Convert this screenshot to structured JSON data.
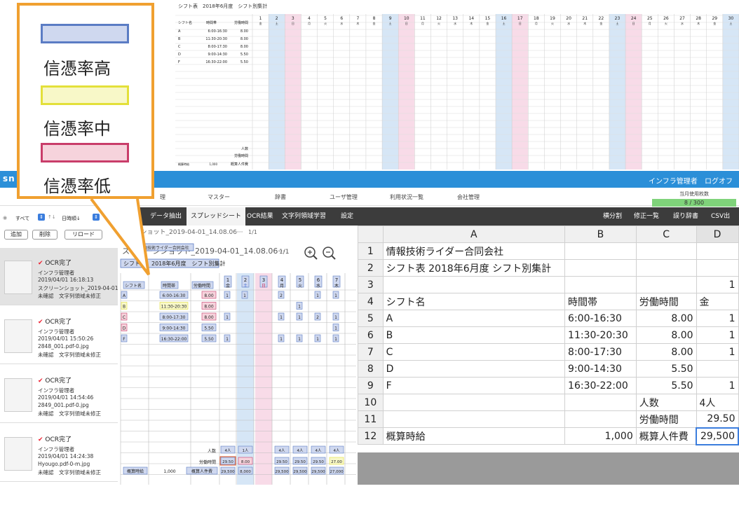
{
  "preview": {
    "title": "シフト表　2018年6月度　シフト別集計",
    "header": [
      "シフト名",
      "時間帯",
      "労働時間"
    ],
    "days": [
      "1",
      "2",
      "3",
      "4",
      "5",
      "6",
      "7",
      "8",
      "9",
      "10",
      "11",
      "12",
      "13",
      "14",
      "15",
      "16",
      "17",
      "18",
      "19",
      "20",
      "21",
      "22",
      "23",
      "24",
      "25",
      "26",
      "27",
      "28",
      "29",
      "30"
    ],
    "weekdays": [
      "金",
      "土",
      "日",
      "月",
      "火",
      "水",
      "木",
      "金",
      "土",
      "日",
      "月",
      "火",
      "水",
      "木",
      "金",
      "土",
      "日",
      "月",
      "火",
      "水",
      "木",
      "金",
      "土",
      "日",
      "月",
      "火",
      "水",
      "木",
      "金",
      "土"
    ],
    "rows": [
      {
        "name": "A",
        "time": "6:00-16:30",
        "hours": "8.00"
      },
      {
        "name": "B",
        "time": "11:30-20:30",
        "hours": "8.00"
      },
      {
        "name": "C",
        "time": "8:00-17:30",
        "hours": "8.00"
      },
      {
        "name": "D",
        "time": "9:00-14:30",
        "hours": "5.50"
      },
      {
        "name": "F",
        "time": "16:30-22:00",
        "hours": "5.50"
      }
    ],
    "footer": {
      "people": "人数",
      "hours": "労働時間",
      "rate": "概算時給",
      "rate_value": "1,000",
      "cost": "概算人件費"
    }
  },
  "appbar": {
    "brand": "sn",
    "user": "インフラ管理者",
    "logoff": "ログオフ"
  },
  "menu": [
    "理",
    "マスター",
    "辞書",
    "ユーザ管理",
    "利用状況一覧",
    "会社管理"
  ],
  "usage": {
    "label": "当月使用枚数",
    "value": "8 / 300"
  },
  "toolbar": {
    "tabs": [
      "データ抽出",
      "スプレッドシート",
      "OCR結果",
      "文字列領域学習",
      "設定"
    ],
    "right": [
      "横分割",
      "修正一覧",
      "誤り辞書",
      "CSV出力"
    ]
  },
  "leftpane": {
    "filter": "すべて",
    "sort": "日時順↓",
    "buttons": [
      "追加",
      "削除",
      "リロード"
    ],
    "cards": [
      {
        "status": "OCR完了",
        "user": "インフラ管理者",
        "date": "2019/04/01 16:18:13",
        "file": "スクリーンショット_2019-04-01",
        "note": "未確認　文字列領域未修正"
      },
      {
        "status": "OCR完了",
        "user": "インフラ管理者",
        "date": "2019/04/01 15:50:26",
        "file": "2848_001.pdf-0.jpg",
        "note": "未確認　文字列領域未修正"
      },
      {
        "status": "OCR完了",
        "user": "インフラ管理者",
        "date": "2019/04/01 14:54:46",
        "file": "2849_001.pdf-0.jpg",
        "note": "未確認　文字列領域未修正"
      },
      {
        "status": "OCR完了",
        "user": "インフラ管理者",
        "date": "2019/04/01 14:24:38",
        "file": "Hyougo.pdf-0-m.jpg",
        "note": "未確認　文字列領域未修正"
      }
    ]
  },
  "ocr": {
    "filename": "リーンショット_2019-04-01_14.08.06···",
    "filename2": "スクリーンショット_2019-04-01_14.08.06···",
    "page": "1/1",
    "company": "情報技術ライダー合同会社",
    "title": "シフト表　2018年6月度　シフト別集計",
    "header": [
      "シフト名",
      "時間帯",
      "労働時間"
    ],
    "days": [
      "1",
      "2",
      "3",
      "4",
      "5",
      "6",
      "7"
    ],
    "weekdays": [
      "金",
      "土",
      "日",
      "月",
      "火",
      "水",
      "木"
    ],
    "rows": [
      {
        "name": "A",
        "time": "6:00-16:30",
        "hours": "8.00"
      },
      {
        "name": "B",
        "time": "11:30-20:30",
        "hours": "8.00"
      },
      {
        "name": "C",
        "time": "8:00-17:30",
        "hours": "8.00"
      },
      {
        "name": "D",
        "time": "9:00-14:30",
        "hours": "5.50"
      },
      {
        "name": "F",
        "time": "16:30-22:00",
        "hours": "5.50"
      }
    ],
    "people_label": "人数",
    "hours_label": "労働時間",
    "rate_label": "概算時給",
    "rate_value": "1,000",
    "cost_label": "概算人件費",
    "people": [
      "4人",
      "1人",
      "",
      "4人",
      "4人",
      "4人",
      "4人"
    ],
    "hours": [
      "29.50",
      "8.00",
      "",
      "29.50",
      "29.50",
      "29.50",
      "27.00"
    ],
    "cost": [
      "29,500",
      "8,000",
      "",
      "29,500",
      "29,500",
      "29,500",
      "27,000"
    ]
  },
  "sheet": {
    "cols": [
      "A",
      "B",
      "C",
      "D"
    ],
    "rows": [
      {
        "n": "1",
        "a": "情報技術ライダー合同会社",
        "b": "",
        "c": "",
        "d": ""
      },
      {
        "n": "2",
        "a": "シフト表 2018年6月度 シフト別集計",
        "b": "",
        "c": "",
        "d": ""
      },
      {
        "n": "3",
        "a": "",
        "b": "",
        "c": "",
        "d": "1"
      },
      {
        "n": "4",
        "a": "シフト名",
        "b": "時間帯",
        "c": "労働時間",
        "d": "金"
      },
      {
        "n": "5",
        "a": "A",
        "b": "6:00-16:30",
        "c": "8.00",
        "d": "1"
      },
      {
        "n": "6",
        "a": "B",
        "b": "11:30-20:30",
        "c": "8.00",
        "d": "1"
      },
      {
        "n": "7",
        "a": "C",
        "b": "8:00-17:30",
        "c": "8.00",
        "d": "1"
      },
      {
        "n": "8",
        "a": "D",
        "b": "9:00-14:30",
        "c": "5.50",
        "d": ""
      },
      {
        "n": "9",
        "a": "F",
        "b": "16:30-22:00",
        "c": "5.50",
        "d": "1"
      },
      {
        "n": "10",
        "a": "",
        "b": "",
        "c": "人数",
        "d": "4人"
      },
      {
        "n": "11",
        "a": "",
        "b": "",
        "c": "労働時間",
        "d": "29.50"
      },
      {
        "n": "12",
        "a": "概算時給",
        "b": "1,000",
        "c": "概算人件費",
        "d": "29,500"
      }
    ]
  },
  "legend": {
    "high": "信憑率高",
    "mid": "信憑率中",
    "low": "信憑率低",
    "colors": {
      "high": "#cfd8ef",
      "high_border": "#5b7cc4",
      "mid": "#f8f8c8",
      "mid_border": "#e3e03a",
      "low": "#f6d3dc",
      "low_border": "#c93d6a"
    }
  }
}
